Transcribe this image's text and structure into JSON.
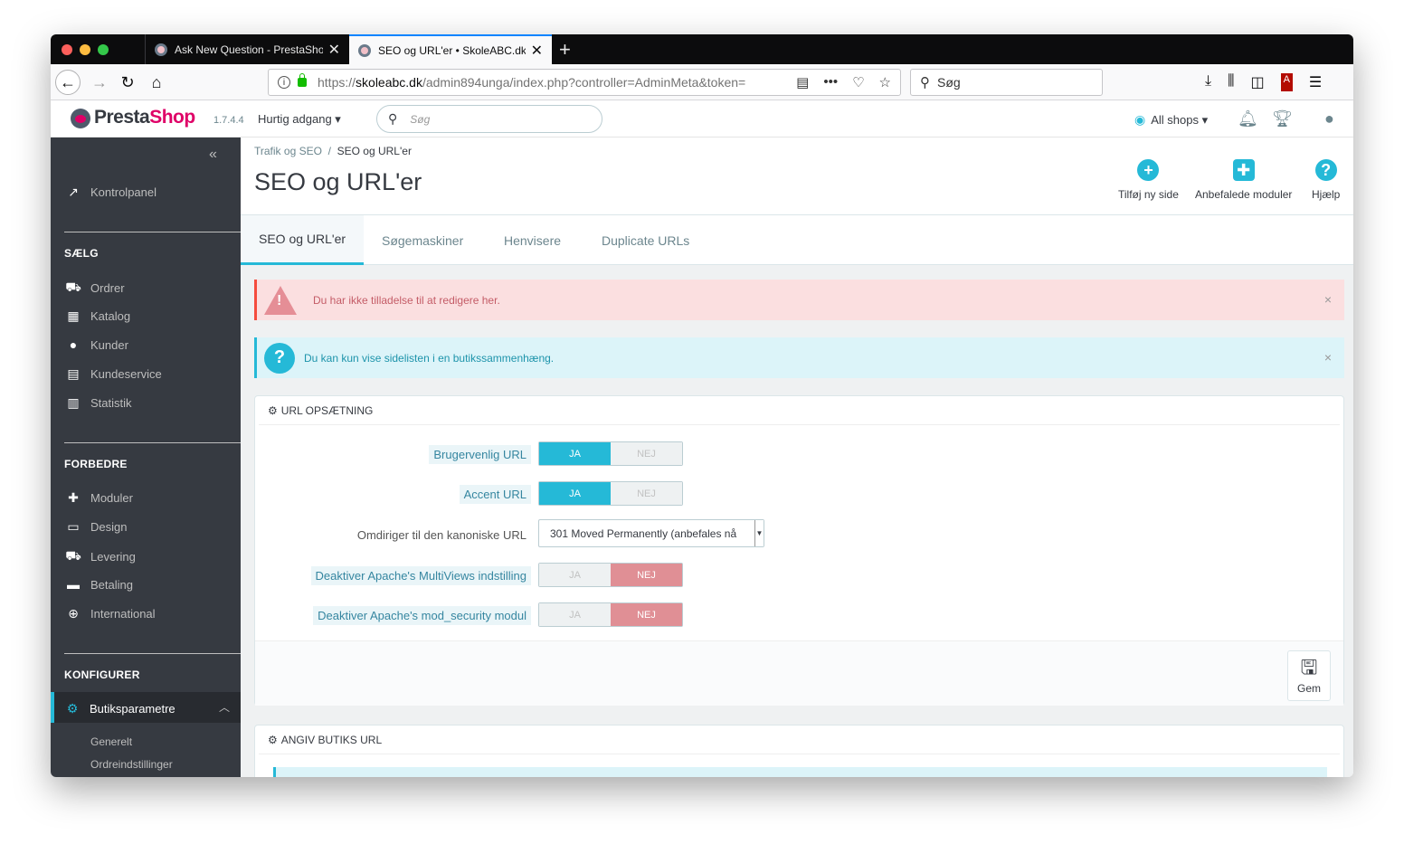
{
  "browser": {
    "tabs": [
      {
        "title": "Ask New Question - PrestaShop",
        "close": "✕"
      },
      {
        "title": "SEO og URL'er • SkoleABC.dk",
        "close": "✕"
      }
    ],
    "new_tab": "+",
    "url_prefix": "https://",
    "url_host": "skoleabc.dk",
    "url_path": "/admin894unga/index.php?controller=AdminMeta&token=",
    "search_placeholder": "Søg"
  },
  "header": {
    "logo_presta": "Presta",
    "logo_shop": "Shop",
    "version": "1.7.4.4",
    "quick_access": "Hurtig adgang ▾",
    "search_placeholder": "Søg",
    "all_shops": "All shops ▾"
  },
  "sidebar": {
    "collapse": "«",
    "dashboard": "Kontrolpanel",
    "sections": [
      {
        "heading": "SÆLG",
        "items": [
          "Ordrer",
          "Katalog",
          "Kunder",
          "Kundeservice",
          "Statistik"
        ]
      },
      {
        "heading": "FORBEDRE",
        "items": [
          "Moduler",
          "Design",
          "Levering",
          "Betaling",
          "International"
        ]
      },
      {
        "heading": "KONFIGURER",
        "items": [
          "Butiksparametre"
        ]
      }
    ],
    "sub_items": [
      "Generelt",
      "Ordreindstillinger"
    ]
  },
  "page": {
    "breadcrumb_parent": "Trafik og SEO",
    "breadcrumb_sep": "/",
    "breadcrumb_current": "SEO og URL'er",
    "title": "SEO og URL'er",
    "toolbar": [
      {
        "label": "Tilføj ny side",
        "icon": "plus-circle-icon"
      },
      {
        "label": "Anbefalede moduler",
        "icon": "puzzle-icon"
      },
      {
        "label": "Hjælp",
        "icon": "help-icon"
      }
    ],
    "tabs": [
      "SEO og URL'er",
      "Søgemaskiner",
      "Henvisere",
      "Duplicate URLs"
    ]
  },
  "alerts": {
    "danger": "Du har ikke tilladelse til at redigere her.",
    "info": "Du kan kun vise sidelisten i en butikssammenhæng.",
    "close": "×"
  },
  "url_panel": {
    "heading": "URL OPSÆTNING",
    "yes": "JA",
    "no": "NEJ",
    "rows": [
      {
        "label": "Brugervenlig URL",
        "value": "JA"
      },
      {
        "label": "Accent URL",
        "value": "JA"
      },
      {
        "label": "Omdiriger til den kanoniske URL",
        "select": "301 Moved Permanently (anbefales nå"
      },
      {
        "label": "Deaktiver Apache's MultiViews indstilling",
        "value": "NEJ"
      },
      {
        "label": "Deaktiver Apache's mod_security modul",
        "value": "NEJ"
      }
    ],
    "save": "Gem"
  },
  "shop_url_panel": {
    "heading": "ANGIV BUTIKS URL"
  },
  "colors": {
    "accent": "#25b9d7",
    "brand": "#df0067",
    "sidebar": "#363a41",
    "danger": "#f54c3e"
  }
}
